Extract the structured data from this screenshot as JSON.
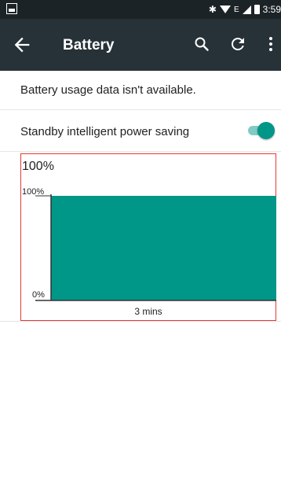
{
  "status_bar": {
    "time": "3:59",
    "network_letter": "E"
  },
  "toolbar": {
    "title": "Battery",
    "background": "#263238"
  },
  "settings": {
    "usage_message": "Battery usage data isn't available.",
    "standby_label": "Standby intelligent power saving",
    "standby_enabled": true,
    "accent": "#009688"
  },
  "chart_data": {
    "type": "area",
    "title": "100%",
    "y_tick_labels": [
      "100%",
      "0%"
    ],
    "ylim": [
      0,
      100
    ],
    "x_tick_labels": [
      "3 mins"
    ],
    "values": [
      100,
      100
    ],
    "fill": "#009688"
  }
}
